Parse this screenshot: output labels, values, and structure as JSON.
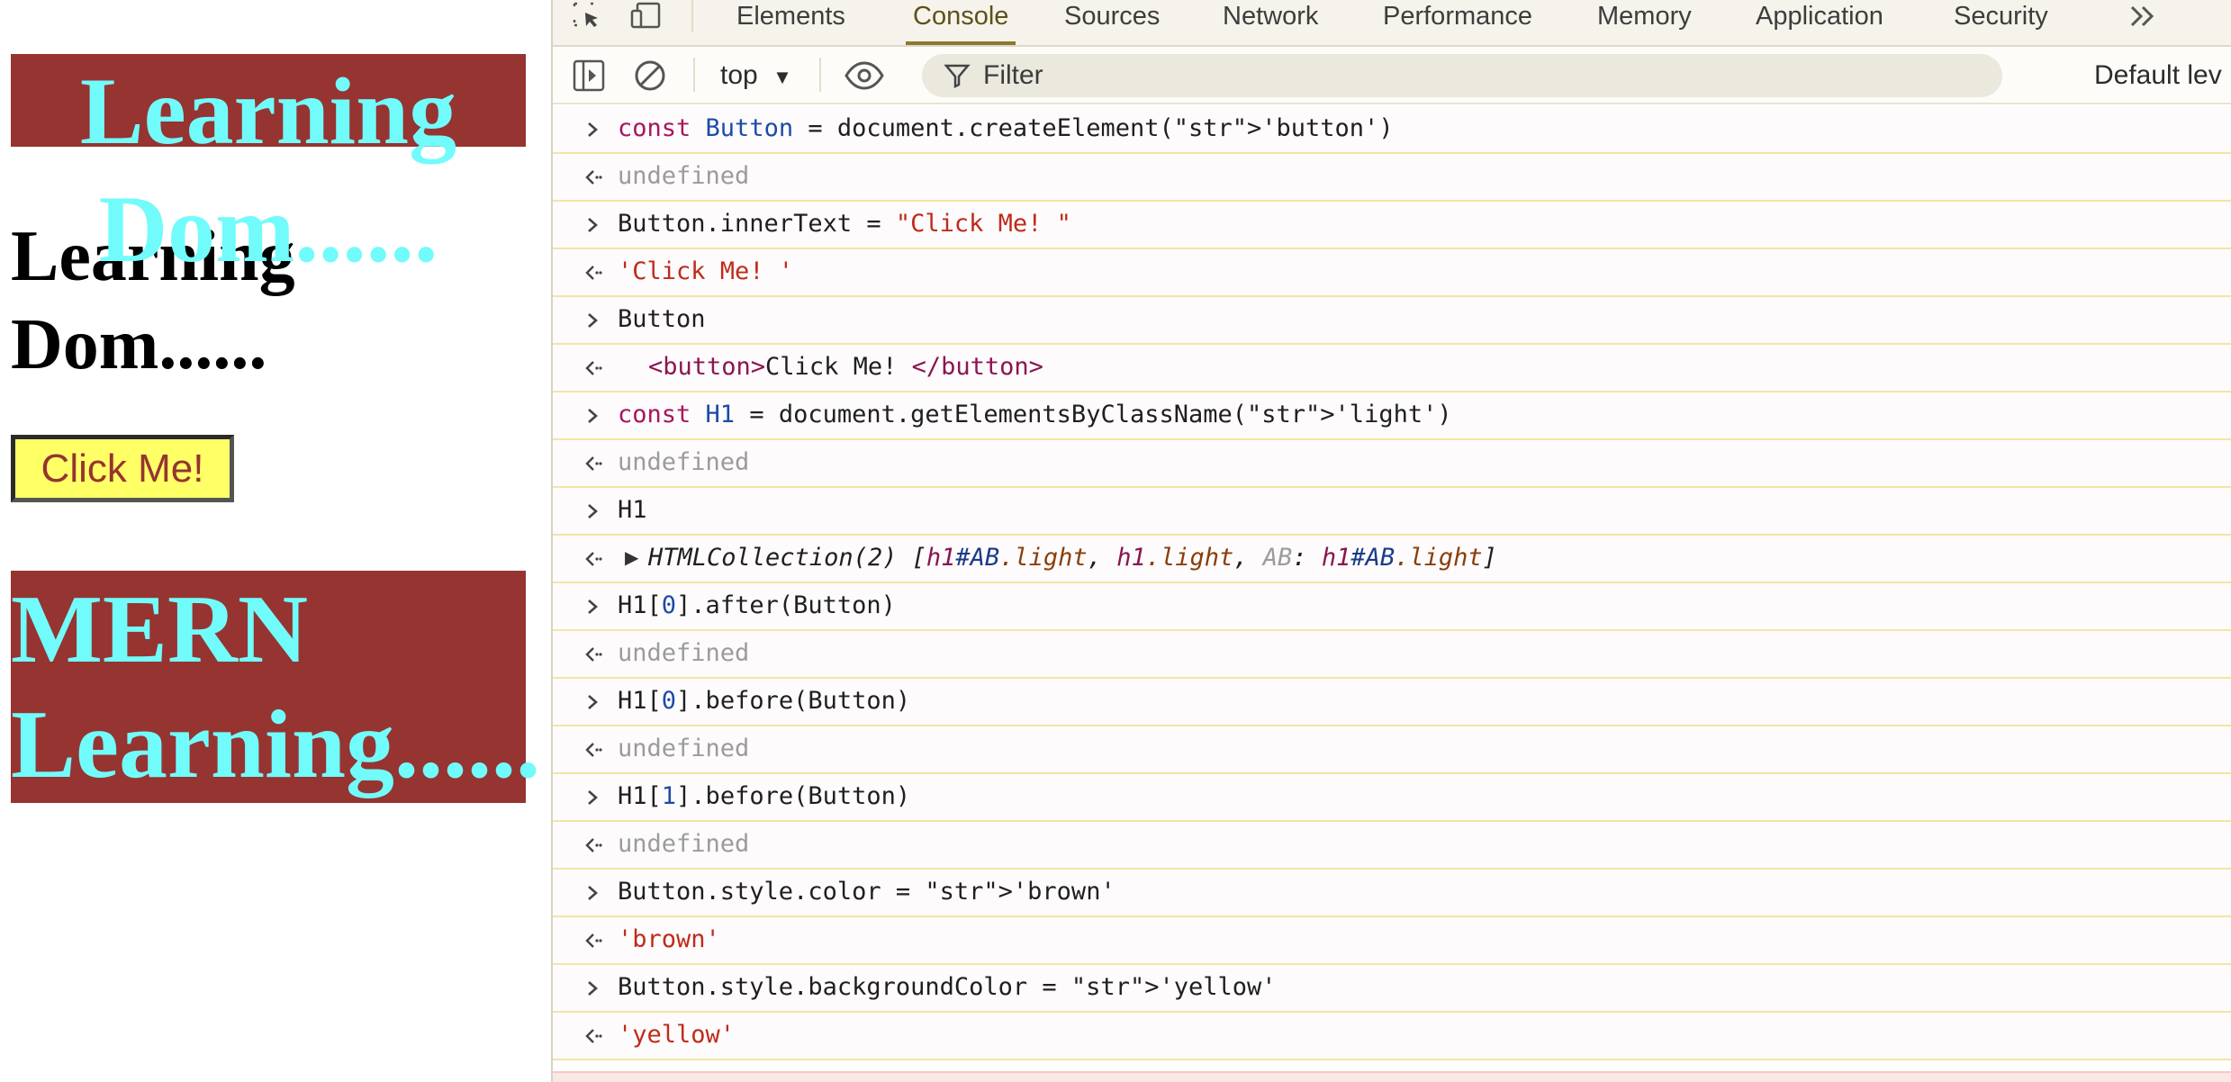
{
  "page": {
    "h1_ab": "Learning Dom......",
    "h1_plain": "Learning Dom......",
    "button_label": "Click Me!",
    "h1_mern": "MERN Learning......",
    "colors": {
      "heading_bg": "#953431",
      "heading_text": "#72fbfb",
      "button_bg": "#ffff66",
      "button_text": "#953431"
    }
  },
  "devtools": {
    "tabs": [
      "Elements",
      "Console",
      "Sources",
      "Network",
      "Performance",
      "Memory",
      "Application",
      "Security"
    ],
    "active_tab": "Console",
    "icons": [
      "inspect-element-icon",
      "device-toolbar-icon",
      "more-tabs-icon",
      "sidebar-toggle-icon",
      "clear-console-icon",
      "live-expression-eye-icon",
      "filter-icon"
    ],
    "context": "top",
    "filter_placeholder": "Filter",
    "levels": "Default lev",
    "console_rows": [
      {
        "type": "input",
        "text": "const Button = document.createElement('button')"
      },
      {
        "type": "output",
        "text": "undefined"
      },
      {
        "type": "input",
        "text": "Button.innerText = \"Click Me! \""
      },
      {
        "type": "output",
        "text": "'Click Me! '"
      },
      {
        "type": "input",
        "text": "Button"
      },
      {
        "type": "output",
        "text": "<button>Click Me! </button>"
      },
      {
        "type": "input",
        "text": "const H1 = document.getElementsByClassName('light')"
      },
      {
        "type": "output",
        "text": "undefined"
      },
      {
        "type": "input",
        "text": "H1"
      },
      {
        "type": "output",
        "text": "HTMLCollection(2) [h1#AB.light, h1.light, AB: h1#AB.light]"
      },
      {
        "type": "input",
        "text": "H1[0].after(Button)"
      },
      {
        "type": "output",
        "text": "undefined"
      },
      {
        "type": "input",
        "text": "H1[0].before(Button)"
      },
      {
        "type": "output",
        "text": "undefined"
      },
      {
        "type": "input",
        "text": "H1[1].before(Button)"
      },
      {
        "type": "output",
        "text": "undefined"
      },
      {
        "type": "input",
        "text": "Button.style.color = 'brown'"
      },
      {
        "type": "output",
        "text": "'brown'"
      },
      {
        "type": "input",
        "text": "Button.style.backgroundColor = 'yellow'"
      },
      {
        "type": "output",
        "text": "'yellow'"
      }
    ]
  }
}
